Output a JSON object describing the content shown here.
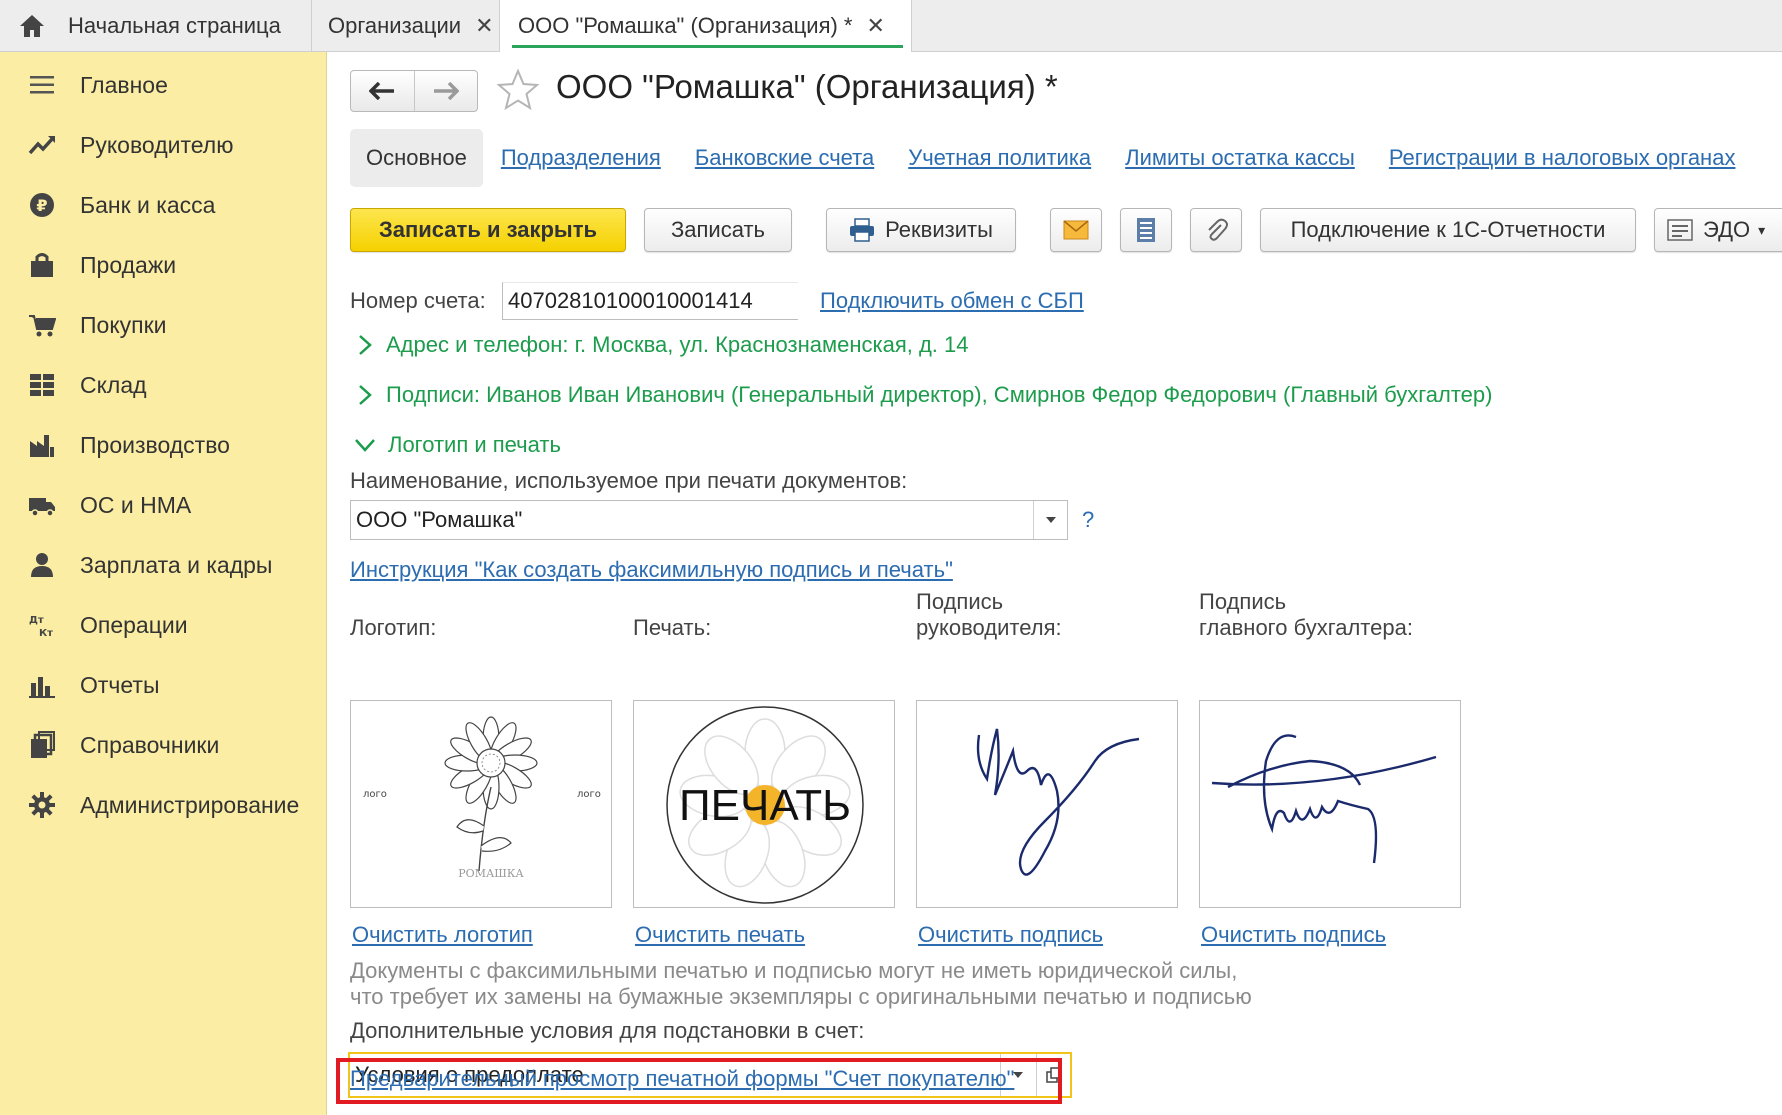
{
  "tabs": {
    "home": "Начальная страница",
    "organizations": "Организации",
    "active": "ООО \"Ромашка\" (Организация) *"
  },
  "sidebar": {
    "items": [
      {
        "label": "Главное",
        "icon": "menu-icon"
      },
      {
        "label": "Руководителю",
        "icon": "trend-icon"
      },
      {
        "label": "Банк и касса",
        "icon": "ruble-icon"
      },
      {
        "label": "Продажи",
        "icon": "bag-icon"
      },
      {
        "label": "Покупки",
        "icon": "cart-icon"
      },
      {
        "label": "Склад",
        "icon": "grid-icon"
      },
      {
        "label": "Производство",
        "icon": "factory-icon"
      },
      {
        "label": "ОС и НМА",
        "icon": "truck-icon"
      },
      {
        "label": "Зарплата и кадры",
        "icon": "person-icon"
      },
      {
        "label": "Операции",
        "icon": "dt-kt-icon"
      },
      {
        "label": "Отчеты",
        "icon": "bar-chart-icon"
      },
      {
        "label": "Справочники",
        "icon": "books-icon"
      },
      {
        "label": "Администрирование",
        "icon": "gear-icon"
      }
    ]
  },
  "header": {
    "title": "ООО \"Ромашка\" (Организация) *"
  },
  "section_tabs": [
    "Основное",
    "Подразделения",
    "Банковские счета",
    "Учетная политика",
    "Лимиты остатка кассы",
    "Регистрации в налоговых органах"
  ],
  "toolbar": {
    "save_close": "Записать и закрыть",
    "save": "Записать",
    "requisites": "Реквизиты",
    "connect_reporting": "Подключение к 1С-Отчетности",
    "edo": "ЭДО"
  },
  "account": {
    "label": "Номер счета:",
    "value": "40702810100010001414",
    "sbp_link": "Подключить обмен с СБП"
  },
  "groups": {
    "address": "Адрес и телефон: г. Москва, ул. Краснознаменская, д. 14",
    "signatures": "Подписи: Иванов Иван Иванович (Генеральный директор), Смирнов Федор Федорович (Главный бухгалтер)",
    "logo_stamp": "Логотип и печать"
  },
  "print_name": {
    "label": "Наименование, используемое при печати документов:",
    "value": "ООО \"Ромашка\"",
    "help": "?"
  },
  "instruction_link": "Инструкция \"Как создать факсимильную подпись и печать\"",
  "images": {
    "logo_label": "Логотип:",
    "stamp_label": "Печать:",
    "director_label_1": "Подпись",
    "director_label_2": "руководителя:",
    "accountant_label_1": "Подпись",
    "accountant_label_2": "главного бухгалтера:",
    "logo_side_text": "лого",
    "logo_brand": "РОМАШКА",
    "stamp_text": "ПЕЧАТЬ",
    "clear_logo": "Очистить логотип",
    "clear_stamp": "Очистить печать",
    "clear_sign_director": "Очистить подпись",
    "clear_sign_accountant": "Очистить подпись"
  },
  "note": {
    "line1": "Документы с факсимильными печатью и подписью могут не иметь юридической силы,",
    "line2": "что требует их замены на бумажные экземпляры с оригинальными печатью и подписью"
  },
  "conditions": {
    "label": "Дополнительные условия для подстановки в счет:",
    "value": "Условия о предоплате"
  },
  "preview_link": "Предварительный просмотр печатной формы \"Счет покупателю\"",
  "colors": {
    "sidebar_bg": "#fbeea4",
    "primary_button": "#f5d100",
    "link": "#2c6cb0",
    "group_title": "#1c9c4c",
    "highlight": "#e11b22",
    "active_tab_underline": "#2aa55a"
  }
}
